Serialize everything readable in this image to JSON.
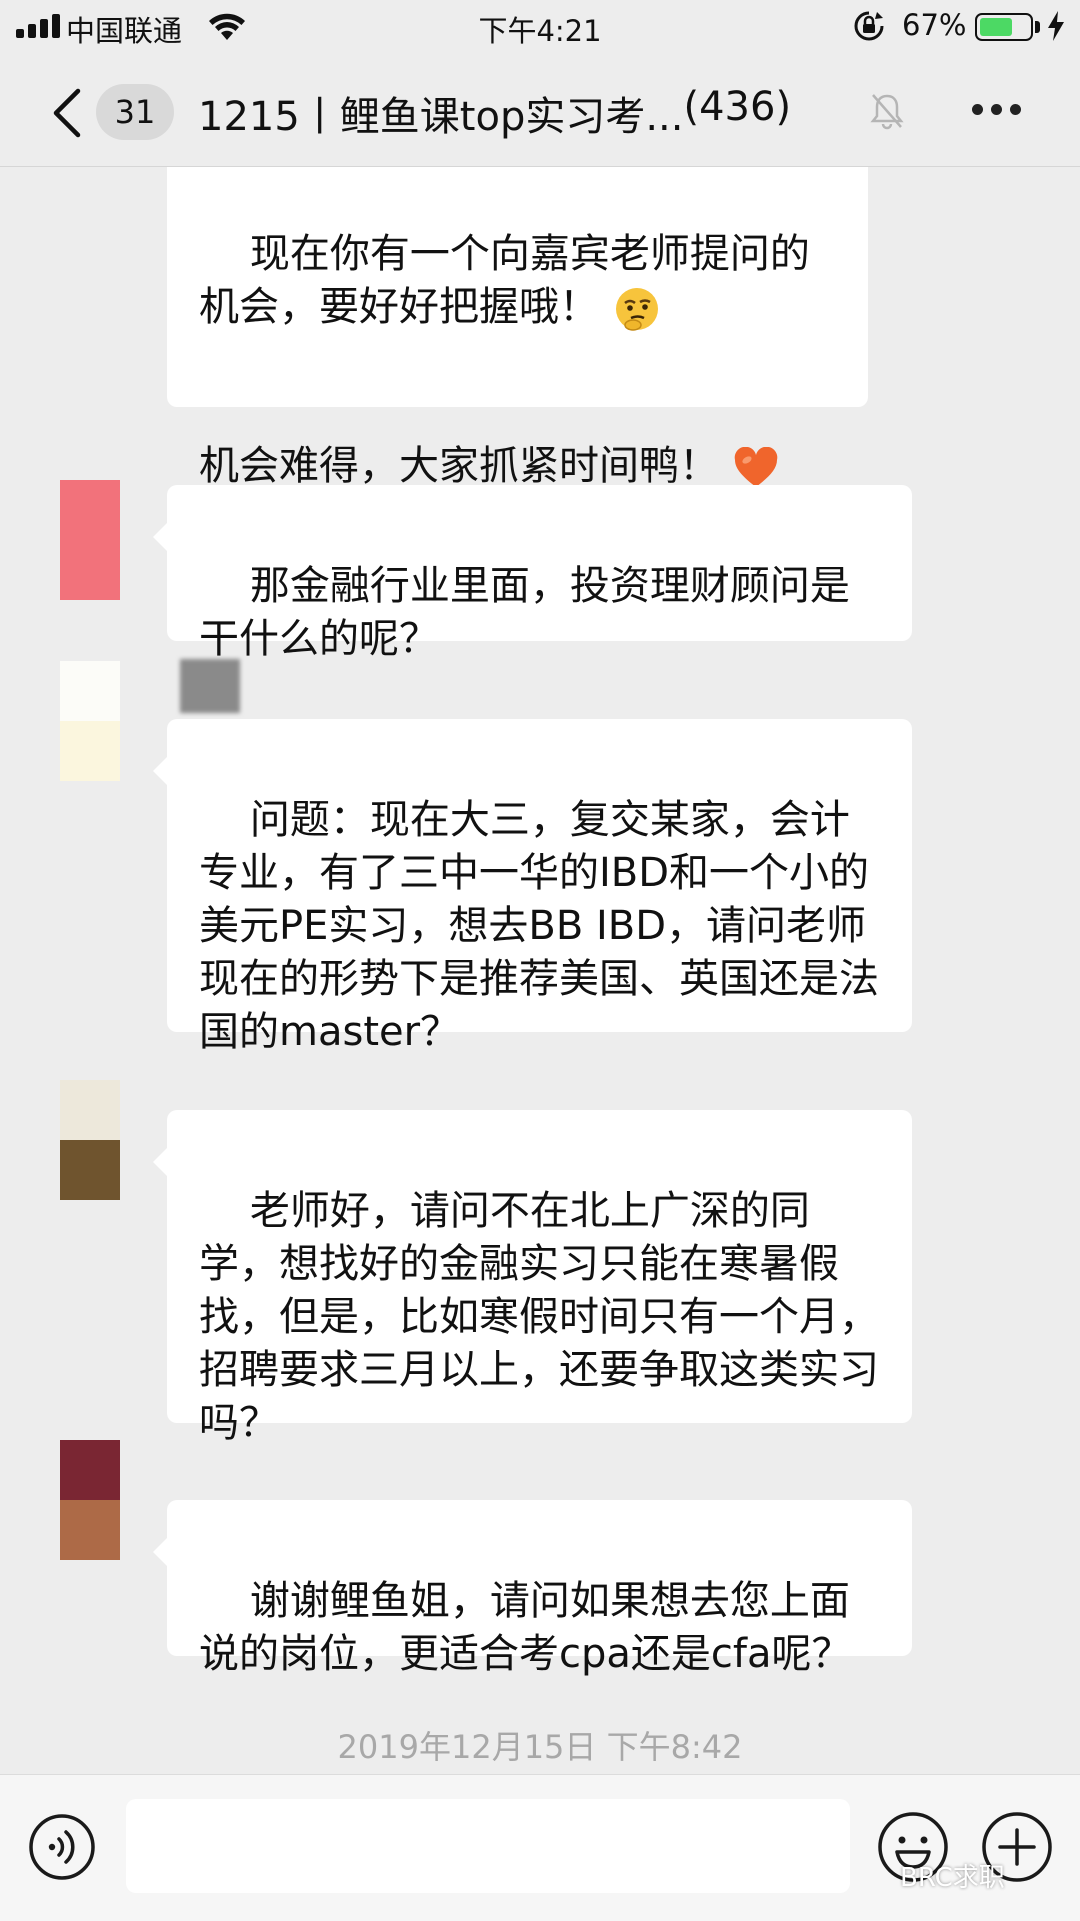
{
  "status_bar": {
    "carrier": "中国联通",
    "time": "下午4:21",
    "battery_percent": "67%",
    "battery_level": 0.67
  },
  "nav": {
    "unread_count": "31",
    "title": "1215丨鲤鱼课top实习考...",
    "member_count": "(436)"
  },
  "messages": [
    {
      "text": "现在你有一个向嘉宾老师提问的机会，要好好把握哦！",
      "emoji": "thinking-face-icon",
      "text2": "机会难得，大家抓紧时间鸭！",
      "emoji2": "orange-heart-icon"
    },
    {
      "text": "那金融行业里面，投资理财顾问是干什么的呢？",
      "avatar_colors": [
        "#f2727b",
        "#f2727b"
      ]
    },
    {
      "text": "问题：现在大三，复交某家，会计专业，有了三中一华的IBD和一个小的美元PE实习，想去BB IBD，请问老师现在的形势下是推荐美国、英国还是法国的master？",
      "avatar_colors": [
        "#fcfcf8",
        "#fbf6de"
      ]
    },
    {
      "text": "老师好，请问不在北上广深的同学，想找好的金融实习只能在寒暑假找，但是，比如寒假时间只有一个月，招聘要求三月以上，还要争取这类实习吗？",
      "avatar_colors": [
        "#ede8db",
        "#6f542e"
      ]
    },
    {
      "text": "谢谢鲤鱼姐，请问如果想去您上面说的岗位，更适合考cpa还是cfa呢？",
      "avatar_colors": [
        "#7a2633",
        "#ad6a47"
      ]
    }
  ],
  "timestamp": "2019年12月15日 下午8:42",
  "input_bar": {
    "watermark": "BRC求职"
  },
  "colors": {
    "background": "#ededed",
    "bubble": "#ffffff",
    "battery": "#4cd964"
  }
}
